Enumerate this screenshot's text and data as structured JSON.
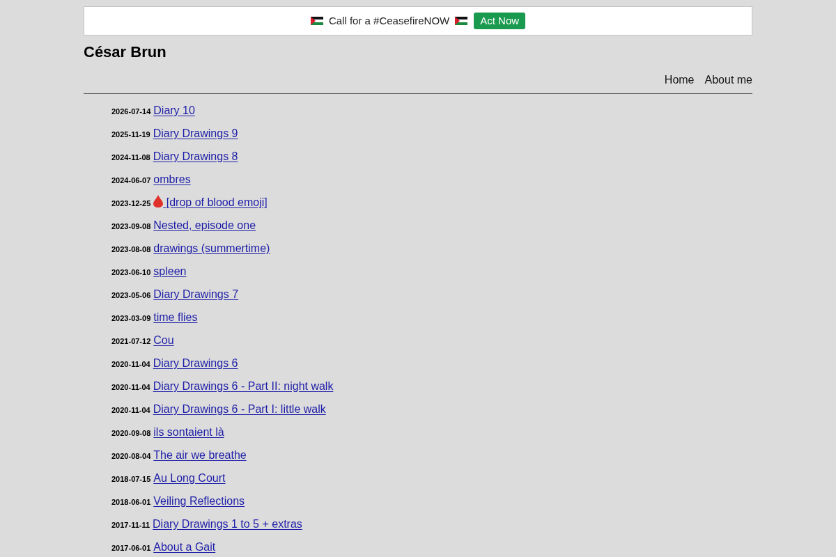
{
  "banner": {
    "message": "Call for a #CeasefireNOW",
    "button": "Act Now"
  },
  "site_title": "César Brun",
  "nav": [
    "Home",
    "About me"
  ],
  "posts": [
    {
      "date": "2026-07-14",
      "title": "Diary 10",
      "kind": "plain"
    },
    {
      "date": "2025-11-19",
      "title": "Diary Drawings 9",
      "kind": "plain"
    },
    {
      "date": "2024-11-08",
      "title": "Diary Drawings 8",
      "kind": "plain"
    },
    {
      "date": "2024-06-07",
      "title": "ombres",
      "kind": "plain"
    },
    {
      "date": "2023-12-25",
      "title": "[drop of blood emoji]",
      "kind": "drop"
    },
    {
      "date": "2023-09-08",
      "title": "Nested, episode one",
      "kind": "plain"
    },
    {
      "date": "2023-08-08",
      "title": "drawings (summertime)",
      "kind": "plain"
    },
    {
      "date": "2023-06-10",
      "title": "spleen",
      "kind": "plain"
    },
    {
      "date": "2023-05-06",
      "title": "Diary Drawings 7",
      "kind": "plain"
    },
    {
      "date": "2023-03-09",
      "title": "time flies",
      "kind": "plain"
    },
    {
      "date": "2021-07-12",
      "title": "Cou",
      "kind": "plain"
    },
    {
      "date": "2020-11-04",
      "title": "Diary Drawings 6",
      "kind": "plain"
    },
    {
      "date": "2020-11-04",
      "title": "Diary Drawings 6 - Part II: night walk",
      "kind": "plain"
    },
    {
      "date": "2020-11-04",
      "title": "Diary Drawings 6 - Part I: little walk",
      "kind": "plain"
    },
    {
      "date": "2020-09-08",
      "title": "ils sontaient là",
      "kind": "plain"
    },
    {
      "date": "2020-08-04",
      "title": "The air we breathe",
      "kind": "plain"
    },
    {
      "date": "2018-07-15",
      "title": "Au Long Court",
      "kind": "plain"
    },
    {
      "date": "2018-06-01",
      "title": "Veiling Reflections",
      "kind": "plain"
    },
    {
      "date": "2017-11-11",
      "title": "Diary Drawings 1 to 5 + extras",
      "kind": "plain"
    },
    {
      "date": "2017-06-01",
      "title": "About a Gait",
      "kind": "plain"
    }
  ]
}
